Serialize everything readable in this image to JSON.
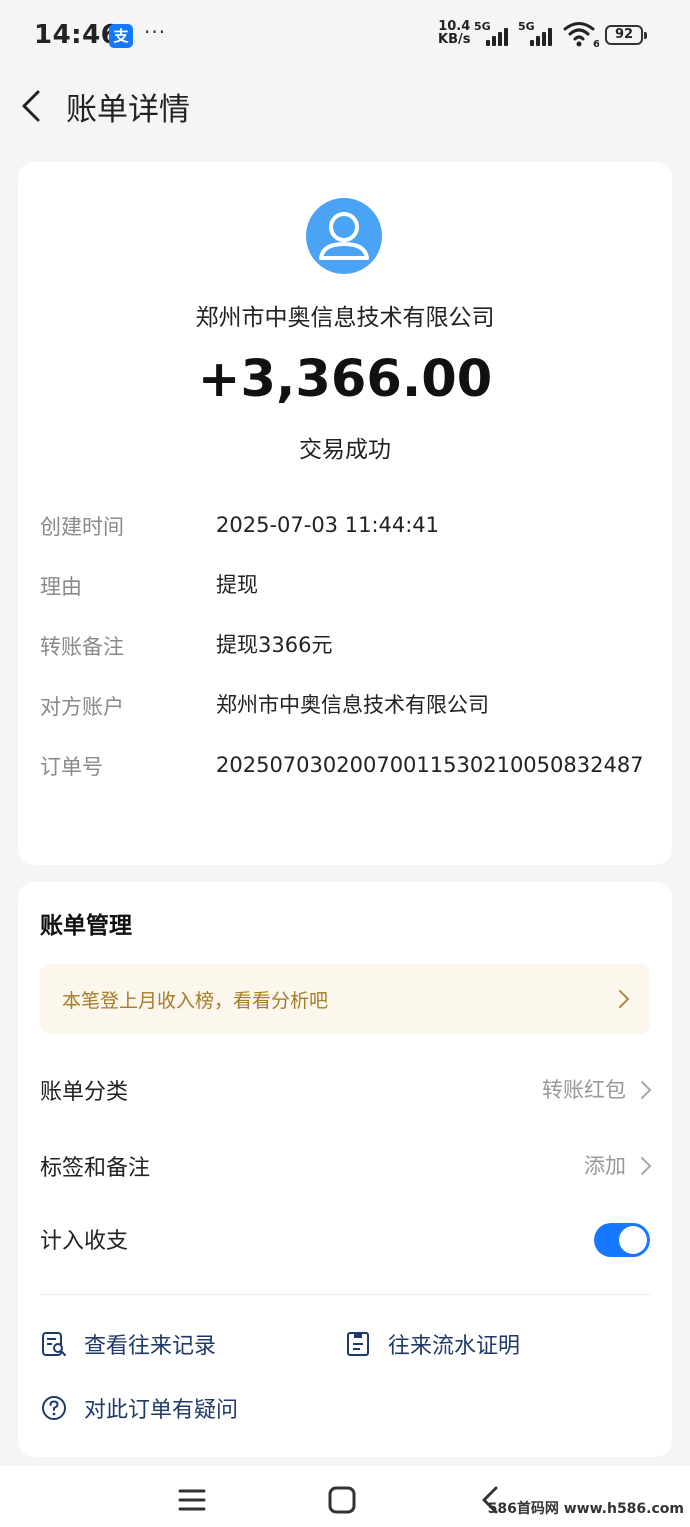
{
  "status_bar": {
    "time": "14:46",
    "app_badge": "支",
    "more": "···",
    "net_speed_value": "10.4",
    "net_speed_unit": "KB/s",
    "signal1_label": "5G",
    "signal2_label": "5G",
    "wifi_sub": "6",
    "battery": "92",
    "icons": [
      "alipay-icon",
      "signal-icon",
      "wifi-icon",
      "battery-icon"
    ]
  },
  "header": {
    "title": "账单详情",
    "back_icon": "chevron-left-icon"
  },
  "detail": {
    "avatar_icon": "user-avatar-icon",
    "merchant": "郑州市中奥信息技术有限公司",
    "amount": "+3,366.00",
    "status": "交易成功",
    "rows": [
      {
        "label": "创建时间",
        "value": "2025-07-03 11:44:41"
      },
      {
        "label": "理由",
        "value": "提现"
      },
      {
        "label": "转账备注",
        "value": "提现3366元"
      },
      {
        "label": "对方账户",
        "value": "郑州市中奥信息技术有限公司"
      },
      {
        "label": "订单号",
        "value": "2025070302007001153021005083248​7"
      }
    ]
  },
  "manage": {
    "title": "账单管理",
    "promo": "本笔登上月收入榜，看看分析吧",
    "category_label": "账单分类",
    "category_value": "转账红包",
    "tags_label": "标签和备注",
    "tags_value": "添加",
    "count_label": "计入收支",
    "count_enabled": true,
    "actions": [
      {
        "label": "查看往来记录",
        "icon": "search-record-icon"
      },
      {
        "label": "往来流水证明",
        "icon": "certificate-icon"
      },
      {
        "label": "对此订单有疑问",
        "icon": "question-icon"
      }
    ]
  },
  "colors": {
    "accent": "#1677ff",
    "avatar": "#4aa3f5",
    "promo_text": "#a87b2a",
    "action_text": "#1f3a6a"
  },
  "bottom_nav": {
    "icons": [
      "menu-icon",
      "home-square-icon",
      "back-icon"
    ],
    "watermark": "586首码网 www.h586.com"
  }
}
